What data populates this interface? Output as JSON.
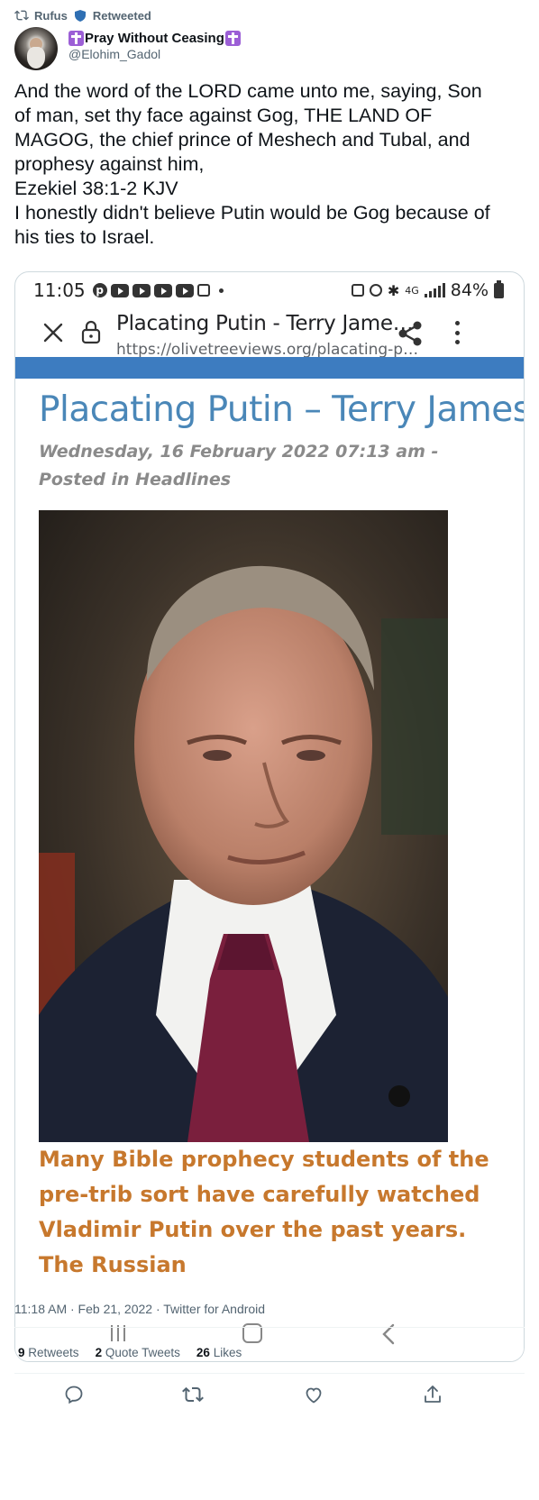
{
  "retweet": {
    "user": "Rufus",
    "label": "Retweeted"
  },
  "author": {
    "display_name": "Pray Without Ceasing",
    "handle": "@Elohim_Gadol"
  },
  "tweet": {
    "lines": [
      "And the word of the LORD came unto me, saying, Son",
      "of man, set thy face against Gog, THE LAND OF",
      "MAGOG, the chief prince of Meshech and Tubal, and",
      "prophesy against him,",
      "Ezekiel 38:1-2 KJV",
      "I honestly didn't believe Putin would be Gog because of",
      "his ties to Israel."
    ]
  },
  "screenshot": {
    "status_time": "11:05",
    "battery": "84%",
    "network": "4G",
    "page_title": "Placating Putin - Terry Jame…",
    "page_url": "https://olivetreeviews.org/placating-p…",
    "article_title": "Placating Putin – Terry James",
    "article_meta": "Wednesday, 16 February 2022 07:13 am - Posted in Headlines",
    "excerpt": "Many Bible prophecy students of the pre-trib sort have carefully watched Vladimir Putin over the past years. The Russian"
  },
  "footer": {
    "timestamp": "11:18 AM · Feb 21, 2022 · Twitter for Android",
    "stats": [
      {
        "count": "9",
        "label": "Retweets"
      },
      {
        "count": "2",
        "label": "Quote Tweets"
      },
      {
        "count": "26",
        "label": "Likes"
      }
    ]
  },
  "colors": {
    "accent": "#1d9bf0",
    "secondary_text": "#536471",
    "article_title": "#4a87b8",
    "excerpt": "#c7782d",
    "site_strip": "#3d7cc0",
    "badge": "#9c5fd6"
  }
}
